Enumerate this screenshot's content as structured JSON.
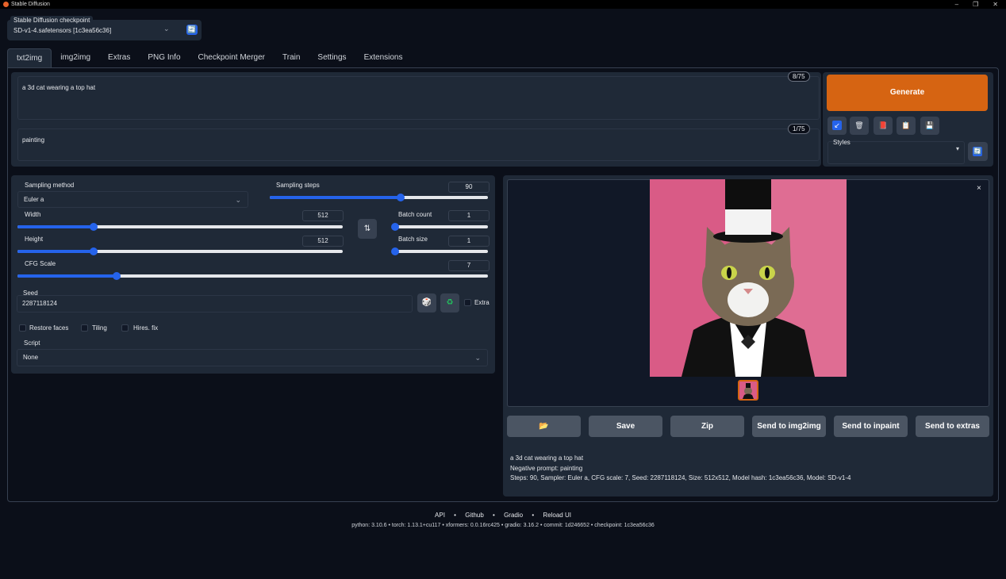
{
  "window": {
    "title": "Stable Diffusion",
    "controls": [
      "–",
      "❐",
      "✕"
    ]
  },
  "checkpoint": {
    "label": "Stable Diffusion checkpoint",
    "value": "SD-v1-4.safetensors [1c3ea56c36]",
    "refresh_icon": "🔄"
  },
  "tabs": [
    "txt2img",
    "img2img",
    "Extras",
    "PNG Info",
    "Checkpoint Merger",
    "Train",
    "Settings",
    "Extensions"
  ],
  "prompt": {
    "text": "a 3d cat wearing a top hat",
    "counter": "8/75"
  },
  "negative_prompt": {
    "text": "painting",
    "counter": "1/75"
  },
  "generate_label": "Generate",
  "tool_icons": [
    "↙",
    "🗑",
    "📕",
    "📋",
    "💾"
  ],
  "styles": {
    "label": "Styles",
    "chev": "▾",
    "refresh_icon": "🔄"
  },
  "params": {
    "sampling_method": {
      "label": "Sampling method",
      "value": "Euler a"
    },
    "sampling_steps": {
      "label": "Sampling steps",
      "value": "90",
      "fraction": 0.6
    },
    "width": {
      "label": "Width",
      "value": "512",
      "fraction": 0.234
    },
    "height": {
      "label": "Height",
      "value": "512",
      "fraction": 0.234
    },
    "swap_icon": "⇅",
    "batch_count": {
      "label": "Batch count",
      "value": "1",
      "fraction": 0.0
    },
    "batch_size": {
      "label": "Batch size",
      "value": "1",
      "fraction": 0.0
    },
    "cfg_scale": {
      "label": "CFG Scale",
      "value": "7",
      "fraction": 0.21
    },
    "seed": {
      "label": "Seed",
      "value": "2287118124",
      "dice_icon": "🎲",
      "recycle_icon": "♻",
      "extra_label": "Extra"
    },
    "restore_faces": "Restore faces",
    "tiling": "Tiling",
    "hires_fix": "Hires. fix",
    "script": {
      "label": "Script",
      "value": "None"
    }
  },
  "gallery": {
    "close_icon": "×"
  },
  "actions": [
    "📂",
    "Save",
    "Zip",
    "Send to img2img",
    "Send to inpaint",
    "Send to extras"
  ],
  "info": {
    "line1": "a 3d cat wearing a top hat",
    "line2": "Negative prompt: painting",
    "line3": "Steps: 90, Sampler: Euler a, CFG scale: 7, Seed: 2287118124, Size: 512x512, Model hash: 1c3ea56c36, Model: SD-v1-4"
  },
  "footer": {
    "links": [
      "API",
      "Github",
      "Gradio",
      "Reload UI"
    ],
    "dot": "•",
    "versions": "python: 3.10.6  •  torch: 1.13.1+cu117  •  xformers: 0.0.16rc425  •  gradio: 3.16.2  •  commit: 1d246652  •  checkpoint: 1c3ea56c36"
  }
}
